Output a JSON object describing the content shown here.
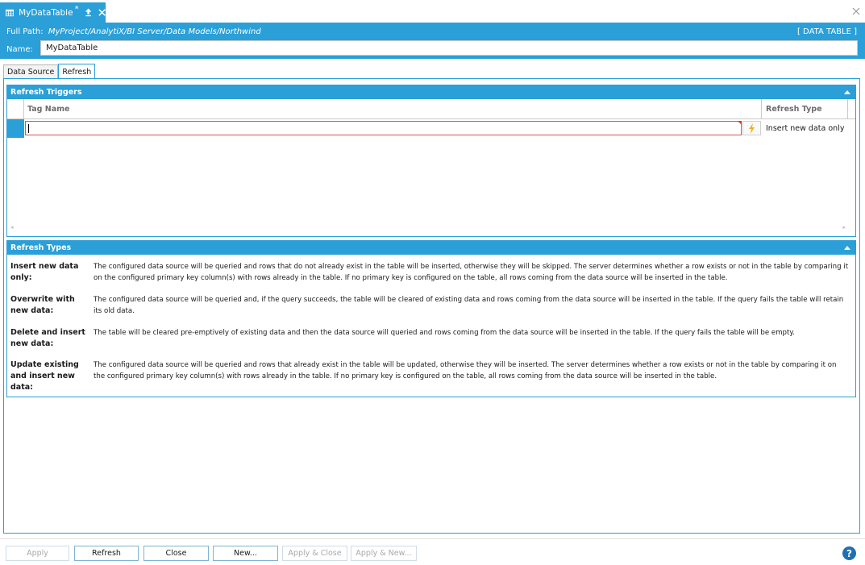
{
  "document_tab": {
    "title": "MyDataTable",
    "dirty_marker": "*"
  },
  "header": {
    "path_label": "Full Path:",
    "path_value": "MyProject/AnalytiX/BI Server/Data Models/Northwind",
    "type_tag": "[ DATA TABLE ]",
    "name_label": "Name:",
    "name_value": "MyDataTable"
  },
  "tabs": [
    {
      "label": "Data Source",
      "active": false
    },
    {
      "label": "Refresh",
      "active": true
    }
  ],
  "refresh_triggers": {
    "title": "Refresh Triggers",
    "columns": [
      "Tag Name",
      "Refresh Type"
    ],
    "rows": [
      {
        "tag_name": "",
        "refresh_type": "Insert new data only"
      }
    ]
  },
  "refresh_types": {
    "title": "Refresh Types",
    "items": [
      {
        "term": "Insert new data only:",
        "description": "The configured data source will be queried and rows that do not already exist in the table will be inserted, otherwise they will be skipped. The server determines whether a row exists or not in the table by comparing it on the configured primary key column(s) with rows already in the table. If no primary key is configured on the table, all rows coming from the data source will be inserted in the table."
      },
      {
        "term": "Overwrite with new data:",
        "description": "The configured data source will be queried and, if the query succeeds, the table will be cleared of existing data and rows coming from the data source will be inserted in the table. If the query fails the table will retain its old data."
      },
      {
        "term": "Delete and insert new data:",
        "description": "The table will be cleared pre-emptively of existing data and then the data source will queried and rows coming from the data source will be inserted in the table. If the query fails the table will be empty."
      },
      {
        "term": "Update existing and insert new data:",
        "description": "The configured data source will be queried and rows that already exist in the table will be updated, otherwise they will be inserted. The server determines whether a row exists or not in the table by comparing it on the configured primary key column(s) with rows already in the table. If no primary key is configured on the table, all rows coming from the data source will be inserted in the table."
      }
    ]
  },
  "footer": {
    "buttons": [
      {
        "label": "Apply",
        "enabled": false
      },
      {
        "label": "Refresh",
        "enabled": true
      },
      {
        "label": "Close",
        "enabled": true
      },
      {
        "label": "New...",
        "enabled": true
      },
      {
        "label": "Apply & Close",
        "enabled": false
      },
      {
        "label": "Apply & New...",
        "enabled": false
      }
    ]
  },
  "icons": {
    "document_tab": "grid-table-icon",
    "pin": "pin-up-arrow-icon",
    "tab_close": "close-icon",
    "window_close": "close-icon",
    "collapse": "chevron-up-icon",
    "tag_picker": "lightning-bolt-icon",
    "help": "help-icon"
  },
  "colors": {
    "accent": "#2a9fd8",
    "error_border": "#e05050",
    "bolt": "#f2b21c",
    "help": "#1f6fb5"
  }
}
